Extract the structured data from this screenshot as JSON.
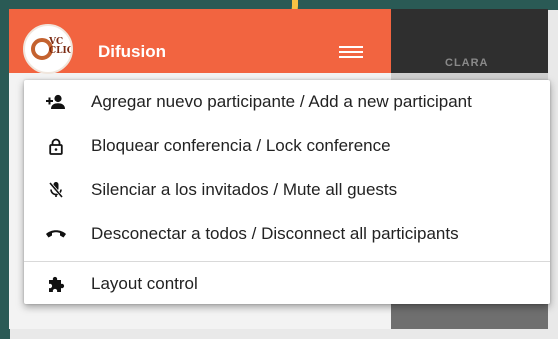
{
  "app": {
    "title": "Difusion",
    "logo_text": "VC CLIC"
  },
  "background": {
    "watermark": "CLARA"
  },
  "menu": {
    "items": [
      {
        "icon": "person-add-icon",
        "label": "Agregar nuevo participante / Add a new participant"
      },
      {
        "icon": "lock-icon",
        "label": "Bloquear conferencia / Lock conference"
      },
      {
        "icon": "mic-off-icon",
        "label": "Silenciar a los invitados / Mute all guests"
      },
      {
        "icon": "call-end-icon",
        "label": "Desconectar a todos / Disconnect all participants"
      },
      {
        "icon": "puzzle-icon",
        "label": "Layout control"
      }
    ]
  },
  "colors": {
    "header": "#f26440",
    "accent_stroke": "#f6c244",
    "page_background": "#2a5a55"
  }
}
